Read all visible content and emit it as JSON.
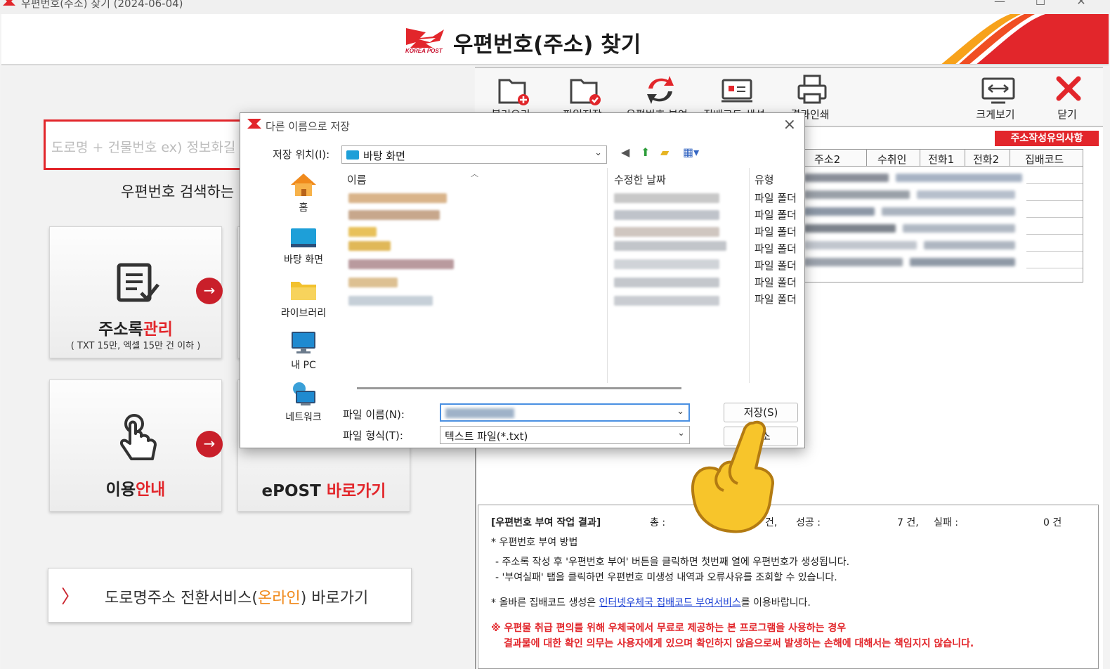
{
  "window": {
    "title": "우편번호(주소) 찾기 (2024-06-04)",
    "controls": [
      "—",
      "☐",
      "✕"
    ]
  },
  "header": {
    "brand": "KOREA POST",
    "title": "우편번호(주소) 찾기",
    "brand_color": "#e2262b"
  },
  "left": {
    "search_placeholder": "도로명 + 건물번호 ex) 정보화길",
    "search_desc": "우편번호 검색하는",
    "cards": {
      "addrbook": {
        "label_main": "주소록",
        "label_accent": "관리",
        "sub": "( TXT 15만, 엑셀 15만 건 이하 )",
        "icon": "document-check-icon"
      },
      "guide": {
        "label_main": "이용",
        "label_accent": "안내",
        "icon": "hand-pointer-icon"
      },
      "epost": {
        "label_main": "ePOST ",
        "label_accent": "바로가기"
      }
    },
    "banner": {
      "chevron": "〉",
      "text_a": "도로명주소 전환서비스(",
      "text_b": "온라인",
      "text_c": ") 바로가기"
    }
  },
  "toolbar": {
    "buttons": [
      {
        "label": "불러오기",
        "icon": "folder-add-icon"
      },
      {
        "label": "파일저장",
        "icon": "folder-check-icon"
      },
      {
        "label": "우편번호 부여",
        "icon": "refresh-arrows-icon"
      },
      {
        "label": "집배코드 생성",
        "icon": "id-card-icon"
      },
      {
        "label": "결과인쇄",
        "icon": "printer-icon"
      },
      {
        "label": "크게보기",
        "icon": "expand-icon"
      },
      {
        "label": "닫기",
        "icon": "close-icon"
      }
    ],
    "notice": "주소작성유의사항"
  },
  "grid": {
    "columns": [
      "주소2",
      "수취인",
      "전화1",
      "전화2",
      "집배코드"
    ]
  },
  "result": {
    "title": "[우편번호 부여 작업 결과]",
    "total_label": "총 :",
    "total_unit": "건,",
    "success_label": "성공 :",
    "success_value": "7 건,",
    "fail_label": "실패 :",
    "fail_value": "0 건",
    "method_title": "* 우편번호 부여 방법",
    "method_1": "- 주소록 작성 후 '우편번호 부여' 버튼을 클릭하면 첫번째 열에 우편번호가 생성됩니다.",
    "method_2": "- '부여실패' 탭을 클릭하면 우편번호 미생성 내역과 오류사유를 조회할 수 있습니다.",
    "code_a": "* 올바른 집배코드 생성은 ",
    "code_link": "인터넷우체국 집배코드 부여서비스",
    "code_b": "를 이용바랍니다.",
    "warn_1": "※ 우편물 취급 편의를 위해 우체국에서 무료로 제공하는 본 프로그램을 사용하는 경우",
    "warn_2": "결과물에 대한 확인 의무는 사용자에게 있으며 확인하지 않음으로써 발생하는 손해에 대해서는 책임지지 않습니다."
  },
  "dialog": {
    "title": "다른 이름으로 저장",
    "location_label": "저장 위치(I):",
    "location_value": "바탕 화면",
    "places": [
      {
        "label": "홈",
        "icon": "home-icon"
      },
      {
        "label": "바탕 화면",
        "icon": "desktop-icon"
      },
      {
        "label": "라이브러리",
        "icon": "library-folder-icon"
      },
      {
        "label": "내 PC",
        "icon": "computer-icon"
      },
      {
        "label": "네트워크",
        "icon": "network-icon"
      }
    ],
    "columns": {
      "name": "이름",
      "modified": "수정한 날짜",
      "type": "유형"
    },
    "file_types": [
      "파일 폴더",
      "파일 폴더",
      "파일 폴더",
      "파일 폴더",
      "파일 폴더",
      "파일 폴더",
      "파일 폴더"
    ],
    "filename_label": "파일 이름(N):",
    "filetype_label": "파일 형식(T):",
    "filetype_value": "텍스트 파일(*.txt)",
    "save_button": "저장(S)",
    "cancel_button": "취소"
  }
}
